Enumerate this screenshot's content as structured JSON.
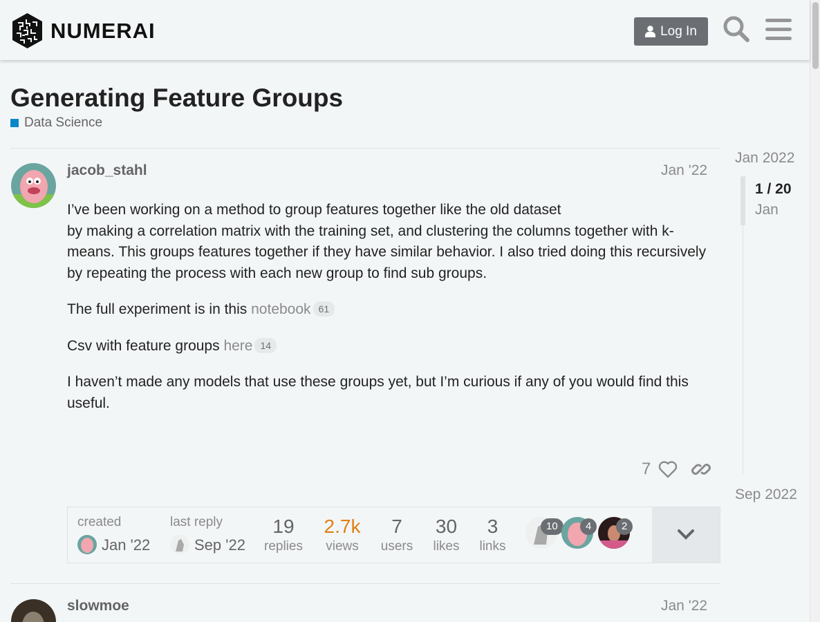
{
  "header": {
    "logo_text": "NUMERAI",
    "login_label": "Log In",
    "search_icon": "search-icon",
    "menu_icon": "hamburger-menu-icon"
  },
  "topic": {
    "title": "Generating Feature Groups",
    "category": "Data Science",
    "category_color": "#0a87c9"
  },
  "post1": {
    "username": "jacob_stahl",
    "date": "Jan '22",
    "para1_line1": "I’ve been working on a method to group features together like the old dataset",
    "para1_rest": "by making a correlation matrix with the training set, and clustering the columns together with k-means. This groups features together if they have similar behavior. I also tried doing this recursively by repeating the process with each new group to find sub groups.",
    "para2_text": "The full experiment is in this",
    "para2_link": "notebook",
    "para2_clicks": "61",
    "para3_text": "Csv with feature groups",
    "para3_link": "here",
    "para3_clicks": "14",
    "para4": "I haven’t made any models that use these groups yet, but I’m curious if any of you would find this useful.",
    "likes": "7"
  },
  "topic_map": {
    "created_label": "created",
    "created_date": "Jan '22",
    "last_reply_label": "last reply",
    "last_reply_date": "Sep '22",
    "stats": [
      {
        "num": "19",
        "label": "replies"
      },
      {
        "num": "2.7k",
        "label": "views",
        "highlight": "#e07f15"
      },
      {
        "num": "7",
        "label": "users"
      },
      {
        "num": "30",
        "label": "likes"
      },
      {
        "num": "3",
        "label": "links"
      }
    ],
    "participants": [
      {
        "count": "10"
      },
      {
        "count": "4"
      },
      {
        "count": "2"
      }
    ]
  },
  "post2": {
    "username": "slowmoe",
    "date": "Jan '22"
  },
  "timeline": {
    "start": "Jan 2022",
    "position": "1 / 20",
    "current": "Jan",
    "end": "Sep 2022"
  }
}
